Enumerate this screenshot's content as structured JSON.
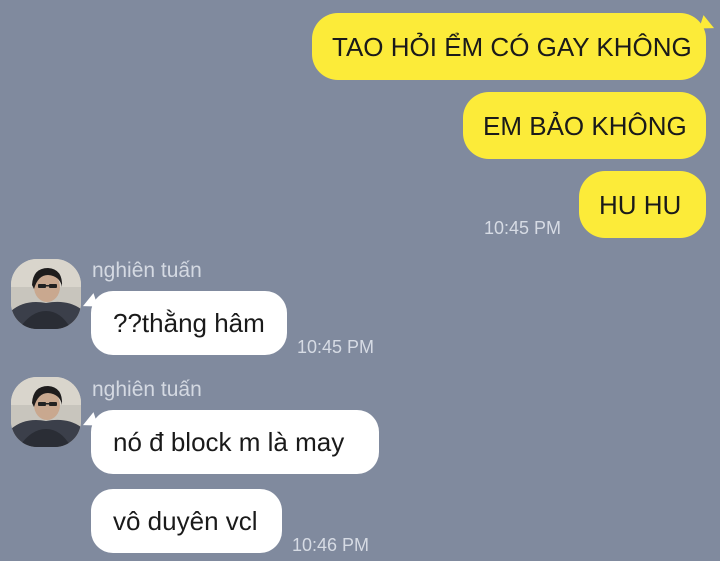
{
  "colors": {
    "background": "#808a9e",
    "outgoing_bubble": "#fceb39",
    "incoming_bubble": "#ffffff",
    "meta_text": "#d6dbe4"
  },
  "outgoing": {
    "messages": [
      "TAO HỎI ỂM CÓ GAY KHÔNG",
      "EM BẢO KHÔNG",
      "HU HU"
    ],
    "time": "10:45 PM"
  },
  "groups": [
    {
      "sender": "nghiên tuấn",
      "avatar_icon": "profile-photo",
      "messages": [
        "??thằng hâm"
      ],
      "time": "10:45 PM"
    },
    {
      "sender": "nghiên tuấn",
      "avatar_icon": "profile-photo",
      "messages": [
        "nó đ block m là may",
        "vô duyên vcl"
      ],
      "time": "10:46 PM"
    }
  ]
}
